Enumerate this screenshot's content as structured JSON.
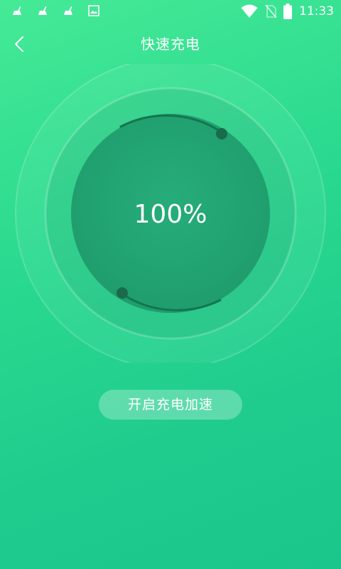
{
  "status_bar": {
    "time": "11:33",
    "left_icons": [
      "cleaner-icon",
      "cleaner-icon",
      "cleaner-icon",
      "image-icon"
    ],
    "right_icons": [
      "wifi-icon",
      "no-sim-icon",
      "battery-icon"
    ]
  },
  "header": {
    "title": "快速充电",
    "back_icon": "chevron-left-icon"
  },
  "gauge": {
    "percent_text": "100%",
    "level": 1.0
  },
  "actions": {
    "boost_label": "开启充电加速"
  },
  "colors": {
    "background_top": "#45ea96",
    "background_bottom": "#1bc68c",
    "inner_circle": "#23a877",
    "ring_dark": "#167a55"
  }
}
